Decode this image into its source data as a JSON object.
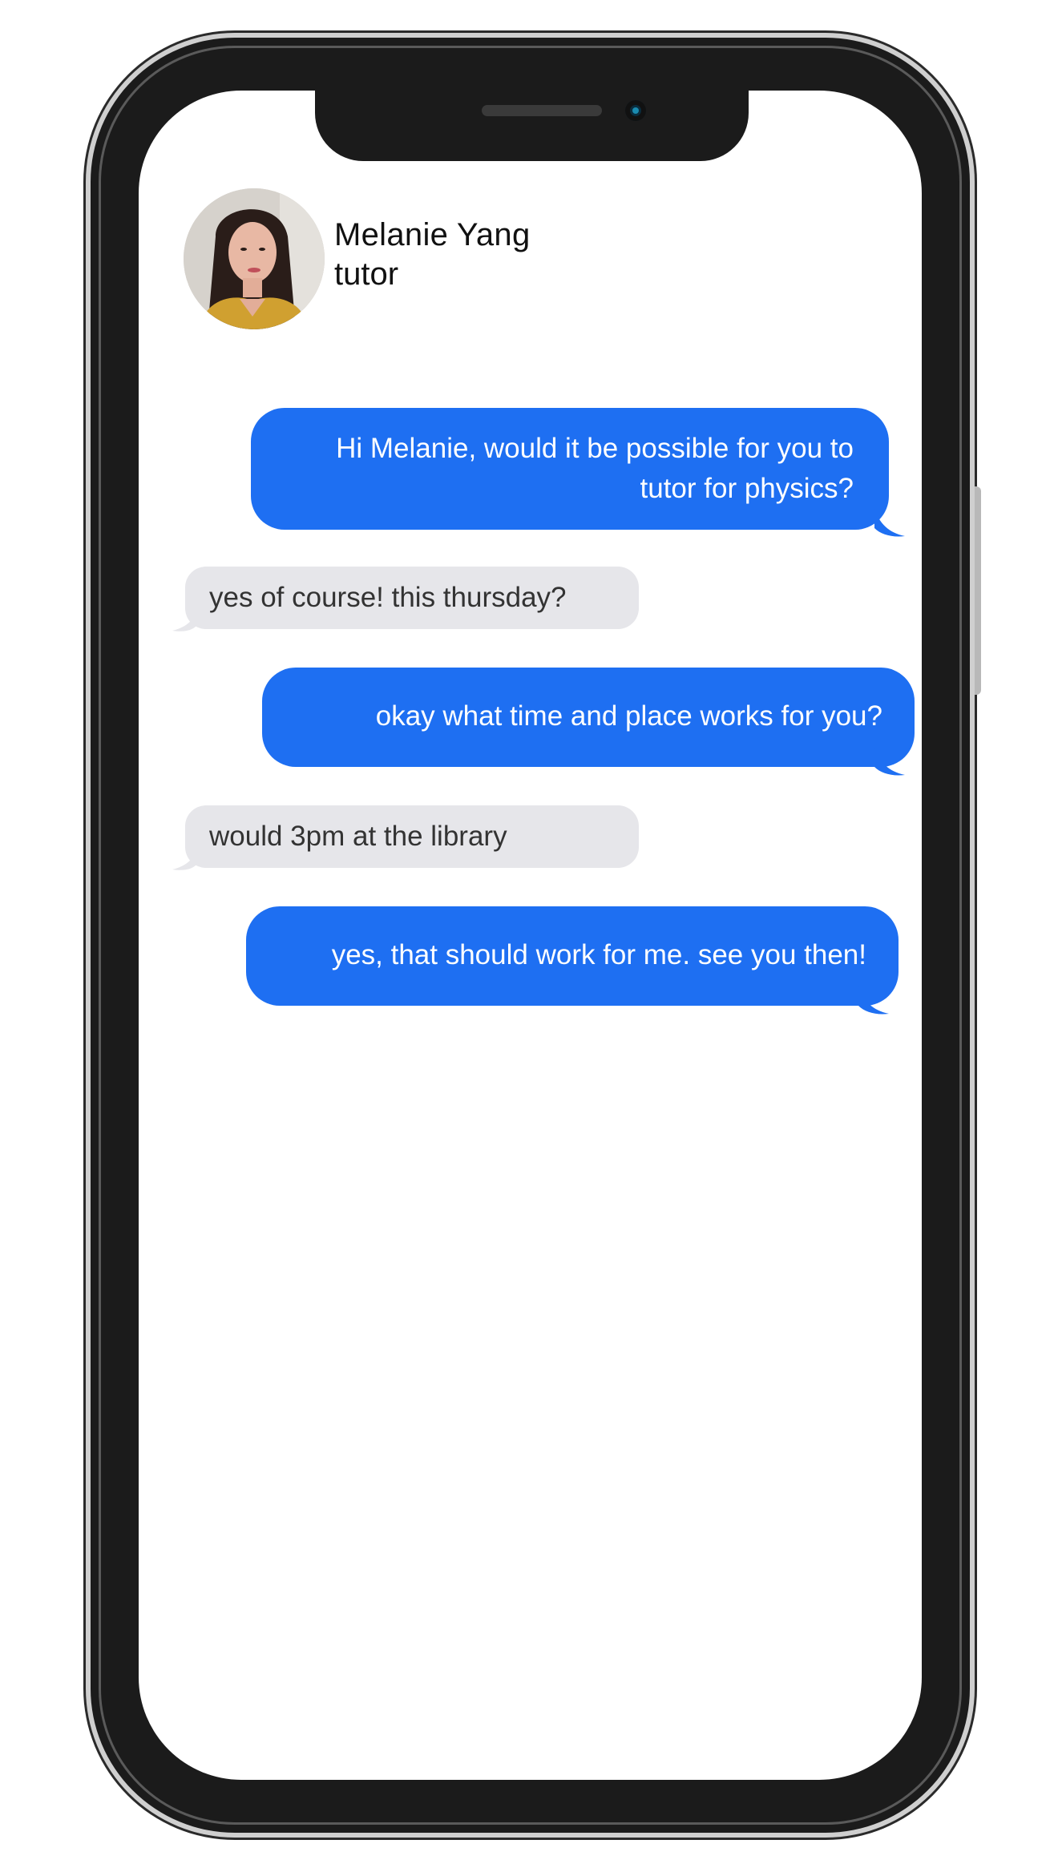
{
  "contact": {
    "name": "Melanie Yang",
    "role": "tutor"
  },
  "messages": [
    {
      "direction": "outgoing",
      "text": "Hi Melanie, would it be possible for you to tutor for physics?"
    },
    {
      "direction": "incoming",
      "text": "yes of course! this thursday?"
    },
    {
      "direction": "outgoing",
      "text": "okay what time and place works for you?"
    },
    {
      "direction": "incoming",
      "text": "would 3pm at the library"
    },
    {
      "direction": "outgoing",
      "text": "yes, that should work for me. see you then!"
    }
  ],
  "colors": {
    "outgoing_bubble": "#1e6ff2",
    "incoming_bubble": "#e6e6ea",
    "phone_frame": "#1b1b1b"
  }
}
